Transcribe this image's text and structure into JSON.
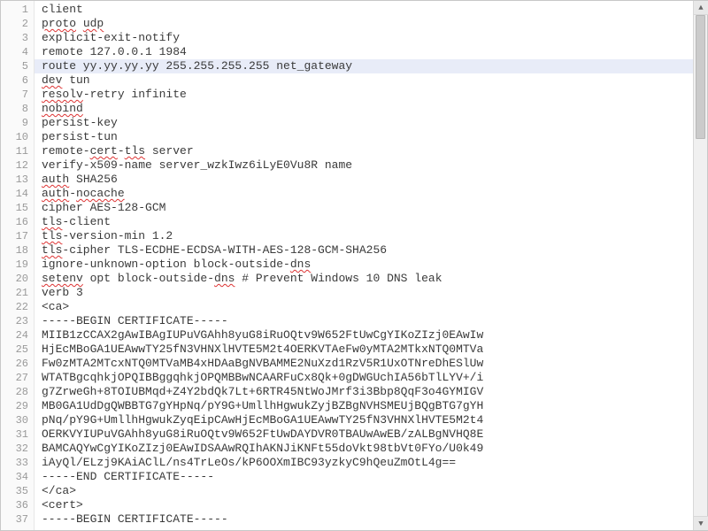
{
  "editor": {
    "highlighted_line": 5,
    "lines": [
      {
        "n": 1,
        "segments": [
          {
            "t": "client"
          }
        ]
      },
      {
        "n": 2,
        "segments": [
          {
            "t": "proto",
            "s": true
          },
          {
            "t": " "
          },
          {
            "t": "udp",
            "s": true
          }
        ]
      },
      {
        "n": 3,
        "segments": [
          {
            "t": "explicit-exit-notify"
          }
        ]
      },
      {
        "n": 4,
        "segments": [
          {
            "t": "remote 127.0.0.1 1984"
          }
        ]
      },
      {
        "n": 5,
        "segments": [
          {
            "t": "route yy.yy.yy.yy 255.255.255.255 net_gateway"
          }
        ]
      },
      {
        "n": 6,
        "segments": [
          {
            "t": "dev",
            "s": true
          },
          {
            "t": " tun"
          }
        ]
      },
      {
        "n": 7,
        "segments": [
          {
            "t": "resolv",
            "s": true
          },
          {
            "t": "-retry infinite"
          }
        ]
      },
      {
        "n": 8,
        "segments": [
          {
            "t": "nobind",
            "s": true
          }
        ]
      },
      {
        "n": 9,
        "segments": [
          {
            "t": "persist-key"
          }
        ]
      },
      {
        "n": 10,
        "segments": [
          {
            "t": "persist-tun"
          }
        ]
      },
      {
        "n": 11,
        "segments": [
          {
            "t": "remote-"
          },
          {
            "t": "cert",
            "s": true
          },
          {
            "t": "-"
          },
          {
            "t": "tls",
            "s": true
          },
          {
            "t": " server"
          }
        ]
      },
      {
        "n": 12,
        "segments": [
          {
            "t": "verify-x509-name server_wzkIwz6iLyE0Vu8R name"
          }
        ]
      },
      {
        "n": 13,
        "segments": [
          {
            "t": "auth",
            "s": true
          },
          {
            "t": " SHA256"
          }
        ]
      },
      {
        "n": 14,
        "segments": [
          {
            "t": "auth",
            "s": true
          },
          {
            "t": "-"
          },
          {
            "t": "nocache",
            "s": true
          }
        ]
      },
      {
        "n": 15,
        "segments": [
          {
            "t": "cipher AES-128-GCM"
          }
        ]
      },
      {
        "n": 16,
        "segments": [
          {
            "t": "tls",
            "s": true
          },
          {
            "t": "-client"
          }
        ]
      },
      {
        "n": 17,
        "segments": [
          {
            "t": "tls",
            "s": true
          },
          {
            "t": "-version-min 1.2"
          }
        ]
      },
      {
        "n": 18,
        "segments": [
          {
            "t": "tls",
            "s": true
          },
          {
            "t": "-cipher TLS-ECDHE-ECDSA-WITH-AES-128-GCM-SHA256"
          }
        ]
      },
      {
        "n": 19,
        "segments": [
          {
            "t": "ignore-unknown-option block-outside-"
          },
          {
            "t": "dns",
            "s": true
          }
        ]
      },
      {
        "n": 20,
        "segments": [
          {
            "t": "setenv",
            "s": true
          },
          {
            "t": " opt block-outside-"
          },
          {
            "t": "dns",
            "s": true
          },
          {
            "t": " # Prevent Windows 10 DNS leak"
          }
        ]
      },
      {
        "n": 21,
        "segments": [
          {
            "t": "verb 3"
          }
        ]
      },
      {
        "n": 22,
        "segments": [
          {
            "t": "<ca>"
          }
        ]
      },
      {
        "n": 23,
        "segments": [
          {
            "t": "-----BEGIN CERTIFICATE-----"
          }
        ]
      },
      {
        "n": 24,
        "segments": [
          {
            "t": "MIIB1zCCAX2gAwIBAgIUPuVGAhh8yuG8iRuOQtv9W652FtUwCgYIKoZIzj0EAwIw"
          }
        ]
      },
      {
        "n": 25,
        "segments": [
          {
            "t": "HjEcMBoGA1UEAwwTY25fN3VHNXlHVTE5M2t4OERKVTAeFw0yMTA2MTkxNTQ0MTVa"
          }
        ]
      },
      {
        "n": 26,
        "segments": [
          {
            "t": "Fw0zMTA2MTcxNTQ0MTVaMB4xHDAaBgNVBAMME2NuXzd1RzV5R1UxOTNreDhESlUw"
          }
        ]
      },
      {
        "n": 27,
        "segments": [
          {
            "t": "WTATBgcqhkjOPQIBBggqhkjOPQMBBwNCAARFuCx8Qk+0gDWGUchIA56bTlLYV+/i"
          }
        ]
      },
      {
        "n": 28,
        "segments": [
          {
            "t": "g7ZrweGh+8TOIUBMqd+Z4Y2bdQk7Lt+6RTR45NtWoJMrf3i3Bbp8QqF3o4GYMIGV"
          }
        ]
      },
      {
        "n": 29,
        "segments": [
          {
            "t": "MB0GA1UdDgQWBBTG7gYHpNq/pY9G+UmllhHgwukZyjBZBgNVHSMEUjBQgBTG7gYH"
          }
        ]
      },
      {
        "n": 30,
        "segments": [
          {
            "t": "pNq/pY9G+UmllhHgwukZyqEipCAwHjEcMBoGA1UEAwwTY25fN3VHNXlHVTE5M2t4"
          }
        ]
      },
      {
        "n": 31,
        "segments": [
          {
            "t": "OERKVYIUPuVGAhh8yuG8iRuOQtv9W652FtUwDAYDVR0TBAUwAwEB/zALBgNVHQ8E"
          }
        ]
      },
      {
        "n": 32,
        "segments": [
          {
            "t": "BAMCAQYwCgYIKoZIzj0EAwIDSAAwRQIhAKNJiKNFt55doVkt98tbVt0FYo/U0k49"
          }
        ]
      },
      {
        "n": 33,
        "segments": [
          {
            "t": "iAyQl/ELzj9KAiAClL/ns4TrLeOs/kP6OOXmIBC93yzkyC9hQeuZmOtL4g=="
          }
        ]
      },
      {
        "n": 34,
        "segments": [
          {
            "t": "-----END CERTIFICATE-----"
          }
        ]
      },
      {
        "n": 35,
        "segments": [
          {
            "t": "</ca>"
          }
        ]
      },
      {
        "n": 36,
        "segments": [
          {
            "t": "<cert>"
          }
        ]
      },
      {
        "n": 37,
        "segments": [
          {
            "t": "-----BEGIN CERTIFICATE-----"
          }
        ]
      }
    ],
    "scroll": {
      "up_glyph": "▲",
      "down_glyph": "▼"
    }
  }
}
